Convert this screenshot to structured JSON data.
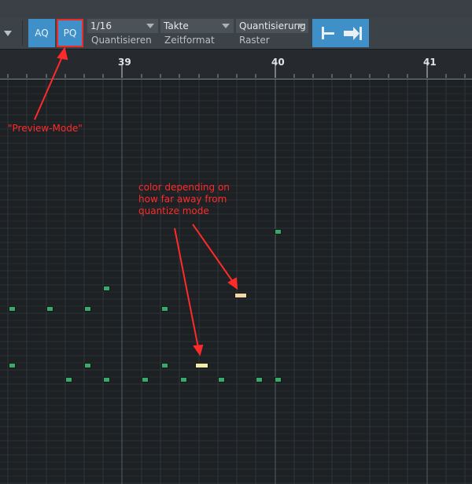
{
  "toolbar": {
    "aq_label": "AQ",
    "pq_label": "PQ",
    "quantize_value": "1/16",
    "quantize_label": "Quantisieren",
    "timeformat_value": "Takte",
    "timeformat_label": "Zeitformat",
    "raster_value": "Quantisierung",
    "raster_label": "Raster"
  },
  "ruler": {
    "bars": [
      "39",
      "40",
      "41"
    ]
  },
  "annotations": {
    "preview_mode": "\"Preview-Mode\"",
    "color_note": [
      "color depending on",
      "how far away from",
      "quantize mode"
    ]
  },
  "colors": {
    "accent_blue": "#3f8fc8",
    "note_green": "#3aa86c",
    "note_highlight": "#f3d7a8",
    "annotation_red": "#ff2a2a"
  }
}
